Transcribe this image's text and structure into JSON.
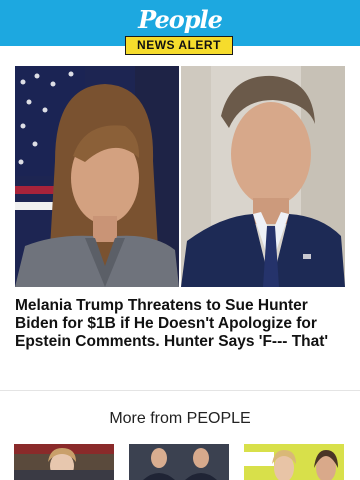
{
  "header": {
    "logo_text": "People",
    "badge_label": "NEWS ALERT",
    "background_color": "#1da8e0",
    "badge_color": "#f6dc2c"
  },
  "article": {
    "headline": "Melania Trump Threatens to Sue Hunter Biden for $1B if He Doesn't Apologize for Epstein Comments. Hunter Says 'F--- That'"
  },
  "more_section": {
    "title": "More from PEOPLE"
  }
}
